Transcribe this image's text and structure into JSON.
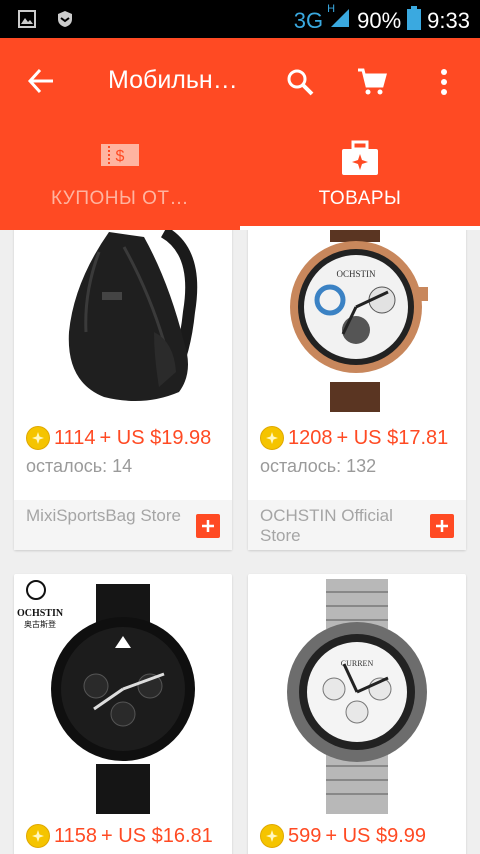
{
  "status_bar": {
    "network": "3G",
    "network_sub": "H",
    "battery": "90%",
    "time": "9:33"
  },
  "toolbar": {
    "title": "Мобильн…"
  },
  "tabs": [
    {
      "label": "КУПОНЫ ОТ…",
      "icon": "coupon-icon",
      "active": false
    },
    {
      "label": "ТОВАРЫ",
      "icon": "briefcase-icon",
      "active": true
    }
  ],
  "products": [
    {
      "coins": "1114",
      "price": "+ US $19.98",
      "left": "осталось: 14",
      "store": "MixiSportsBag Store",
      "image": "sling-backpack"
    },
    {
      "coins": "1208",
      "price": "+ US $17.81",
      "left": "осталось: 132",
      "store": "OCHSTIN Official Store",
      "image": "watch-brown-strap",
      "image_brand": "OCHSTIN"
    },
    {
      "coins": "1158",
      "price": "+ US $16.81",
      "image": "watch-black",
      "image_brand": "OCHSTIN",
      "image_brand_cn": "奥古斯登"
    },
    {
      "coins": "599",
      "price": "+ US $9.99",
      "image": "watch-steel",
      "image_brand": "CURREN"
    }
  ],
  "colors": {
    "accent": "#ff4a23",
    "coin": "#f5c400",
    "background": "#efefef"
  }
}
